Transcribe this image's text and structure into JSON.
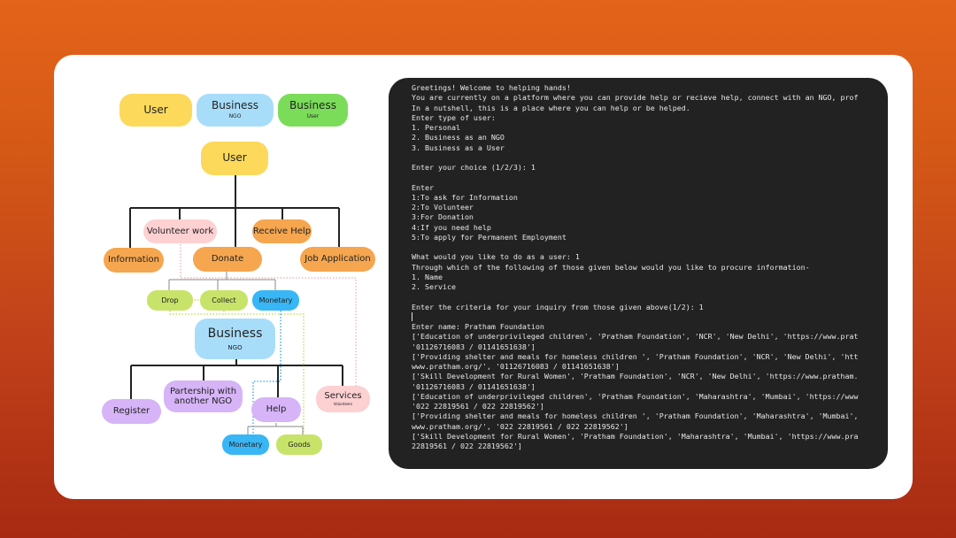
{
  "legend": [
    {
      "label": "User",
      "sub": ""
    },
    {
      "label": "Business",
      "sub": "NGO"
    },
    {
      "label": "Business",
      "sub": "User"
    }
  ],
  "diagram": {
    "root": "User",
    "user_branches": {
      "volunteer": "Volunteer work",
      "receive_help": "Receive Help",
      "information": "Information",
      "donate": "Donate",
      "job_application": "Job Application"
    },
    "donate_children": {
      "drop": "Drop",
      "collect": "Collect",
      "monetary": "Monetary"
    },
    "business": {
      "label": "Business",
      "sub": "NGO"
    },
    "business_branches": {
      "register": "Register",
      "partnership": "Partership with another NGO",
      "help": "Help",
      "services": "Services",
      "services_sub": "Volunteers"
    },
    "help_children": {
      "monetary": "Monetary",
      "goods": "Goods"
    }
  },
  "terminal": {
    "lines": [
      "Greetings! Welcome to helping hands!",
      "You are currently on a platform where you can provide help or recieve help, connect with an NGO, prof",
      "In a nutshell, this is a place where you can help or be helped.",
      "Enter type of user:",
      "1. Personal",
      "2. Business as an NGO",
      "3. Business as a User",
      "",
      "Enter your choice (1/2/3): 1",
      "",
      "Enter",
      "1:To ask for Information",
      "2:To Volunteer",
      "3:For Donation",
      "4:If you need help",
      "5:To apply for Permanent Employment",
      "",
      "What would you like to do as a user: 1",
      "Through which of the following of those given below would you like to procure information-",
      "1. Name",
      "2. Service",
      "",
      "Enter the criteria for your inquiry from those given above(1/2): 1",
      "",
      "Enter name: Pratham Foundation",
      "['Education of underprivileged children', 'Pratham Foundation', 'NCR', 'New Delhi', 'https://www.prat",
      "'01126716083 / 01141651638']",
      "['Providing shelter and meals for homeless children ', 'Pratham Foundation', 'NCR', 'New Delhi', 'htt",
      "www.pratham.org/', '01126716083 / 01141651638']",
      "['Skill Development for Rural Women', 'Pratham Foundation', 'NCR', 'New Delhi', 'https://www.pratham.",
      "'01126716083 / 01141651638']",
      "['Education of underprivileged children', 'Pratham Foundation', 'Maharashtra', 'Mumbai', 'https://www",
      "'022 22819561 / 022 22819562']",
      "['Providing shelter and meals for homeless children ', 'Pratham Foundation', 'Maharashtra', 'Mumbai',",
      "www.pratham.org/', '022 22819561 / 022 22819562']",
      "['Skill Development for Rural Women', 'Pratham Foundation', 'Maharashtra', 'Mumbai', 'https://www.pra",
      "22819561 / 022 22819562']"
    ]
  }
}
